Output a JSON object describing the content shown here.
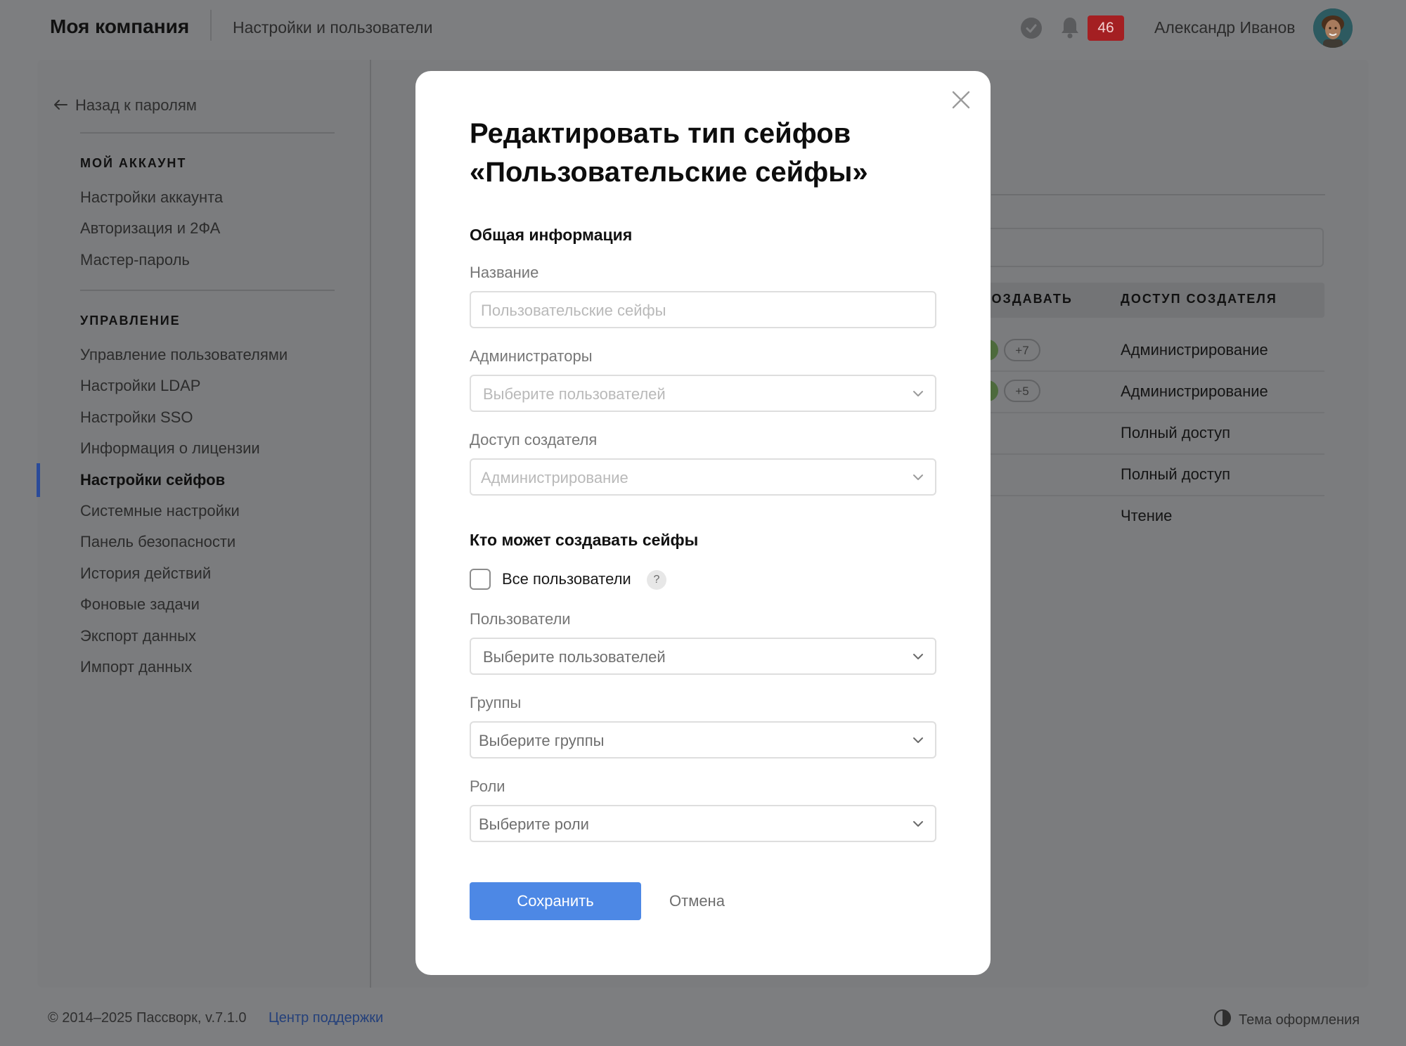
{
  "header": {
    "company": "Моя компания",
    "subtitle": "Настройки и пользователи",
    "notifications_count": "46",
    "user_name": "Александр Иванов"
  },
  "sidebar": {
    "back_label": "Назад к паролям",
    "sections": [
      {
        "title": "МОЙ АККАУНТ",
        "items": [
          "Настройки аккаунта",
          "Авторизация и 2ФА",
          "Мастер-пароль"
        ]
      },
      {
        "title": "УПРАВЛЕНИЕ",
        "items": [
          "Управление пользователями",
          "Настройки LDAP",
          "Настройки SSO",
          "Информация о лицензии",
          "Настройки сейфов",
          "Системные настройки",
          "Панель безопасности",
          "История действий",
          "Фоновые задачи",
          "Экспорт данных",
          "Импорт данных"
        ]
      }
    ],
    "active_item": "Настройки сейфов"
  },
  "background_table": {
    "headers": [
      "Т СОЗДАВАТЬ",
      "ДОСТУП СОЗДАТЕЛЯ"
    ],
    "rows": [
      {
        "extra": "+7",
        "access": "Администрирование"
      },
      {
        "extra": "+5",
        "access": "Администрирование"
      },
      {
        "extra": "",
        "access": "Полный доступ"
      },
      {
        "extra": "",
        "access": "Полный доступ"
      },
      {
        "extra": "",
        "access": "Чтение"
      }
    ]
  },
  "modal": {
    "title": "Редактировать тип сейфов «Пользовательские сейфы»",
    "general_heading": "Общая информация",
    "name_label": "Название",
    "name_placeholder": "Пользовательские сейфы",
    "admins_label": "Администраторы",
    "admins_placeholder": "Выберите пользователей",
    "creator_access_label": "Доступ создателя",
    "creator_access_value": "Администрирование",
    "who_can_create_heading": "Кто может создавать сейфы",
    "all_users_label": "Все пользователи",
    "all_users_checked": false,
    "help_symbol": "?",
    "users_label": "Пользователи",
    "users_placeholder": "Выберите пользователей",
    "groups_label": "Группы",
    "groups_placeholder": "Выберите группы",
    "roles_label": "Роли",
    "roles_placeholder": "Выберите роли",
    "save_label": "Сохранить",
    "cancel_label": "Отмена"
  },
  "footer": {
    "copyright": "© 2014–2025 Пассворк, v.7.1.0",
    "support_label": "Центр поддержки",
    "theme_label": "Тема оформления"
  },
  "colors": {
    "overlay": "#7d7e80",
    "primary_button": "#4d88e5",
    "badge": "#a41f22",
    "active_bar": "#2a4b9a",
    "link": "#24407a"
  },
  "icons": [
    "check-circle-icon",
    "bell-icon",
    "arrow-left-icon",
    "close-icon",
    "chevron-down-icon",
    "help-icon",
    "theme-contrast-icon"
  ]
}
